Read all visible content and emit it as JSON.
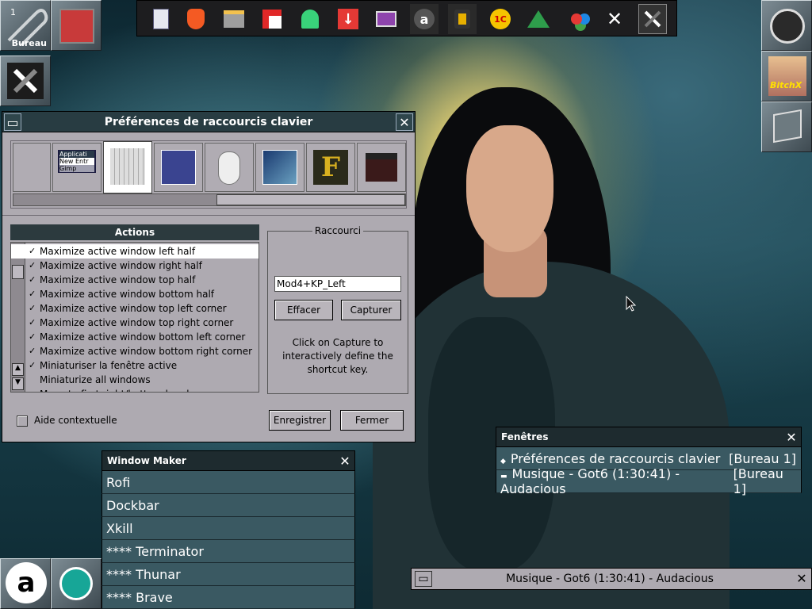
{
  "workspace": {
    "number": "1",
    "name": "Bureau"
  },
  "topdock": {
    "icons": [
      "search-doc-icon",
      "brave-icon",
      "files-icon",
      "flipboard-icon",
      "ghost-icon",
      "download-icon",
      "settings-monitor-icon",
      "a-icon",
      "audio-speaker-icon",
      "1c-icon",
      "plant-icon",
      "circles-icon",
      "close-x-icon",
      "xkill-icon"
    ],
    "labels": {
      "a": "a",
      "onec": "1C",
      "x": "✕"
    }
  },
  "right_dock": {
    "bitchx_label": "BitchX"
  },
  "prefs": {
    "title": "Préférences de raccourcis clavier",
    "actions_header": "Actions",
    "shortcut_group": "Raccourci",
    "shortcut_value": "Mod4+KP_Left",
    "clear_label": "Effacer",
    "capture_label": "Capturer",
    "help_text": "Click on Capture to interactively define the shortcut key.",
    "context_help": "Aide contextuelle",
    "save_label": "Enregistrer",
    "close_label": "Fermer",
    "tab_texts": [
      "Applicati",
      "New Entr",
      "Gimp"
    ],
    "actions": [
      {
        "label": "Maximize active window left half",
        "checked": true,
        "selected": true
      },
      {
        "label": "Maximize active window right half",
        "checked": true
      },
      {
        "label": "Maximize active window top half",
        "checked": true
      },
      {
        "label": "Maximize active window bottom half",
        "checked": true
      },
      {
        "label": "Maximize active window top left corner",
        "checked": true
      },
      {
        "label": "Maximize active window top right corner",
        "checked": true
      },
      {
        "label": "Maximize active window bottom left corner",
        "checked": true
      },
      {
        "label": "Maximize active window bottom right corner",
        "checked": true
      },
      {
        "label": "Miniaturiser la fenêtre active",
        "checked": true
      },
      {
        "label": "Miniaturize all windows",
        "checked": false
      },
      {
        "label": "Move to first right/bottom head",
        "checked": false
      }
    ]
  },
  "window_maker_menu": {
    "title": "Window Maker",
    "items": [
      "Rofi",
      "Dockbar",
      "Xkill",
      "**** Terminator",
      "**** Thunar",
      "**** Brave"
    ]
  },
  "windows_list": {
    "title": "Fenêtres",
    "items": [
      {
        "bullet": "◆",
        "label": "Préférences de raccourcis clavier",
        "desk": "[Bureau 1]"
      },
      {
        "bullet": "▬",
        "label": "Musique - Got6 (1:30:41) - Audacious",
        "desk": "[Bureau 1]"
      }
    ]
  },
  "audacious": {
    "title": "Musique - Got6 (1:30:41) - Audacious"
  },
  "bottom_dock": {
    "a_label": "a"
  }
}
